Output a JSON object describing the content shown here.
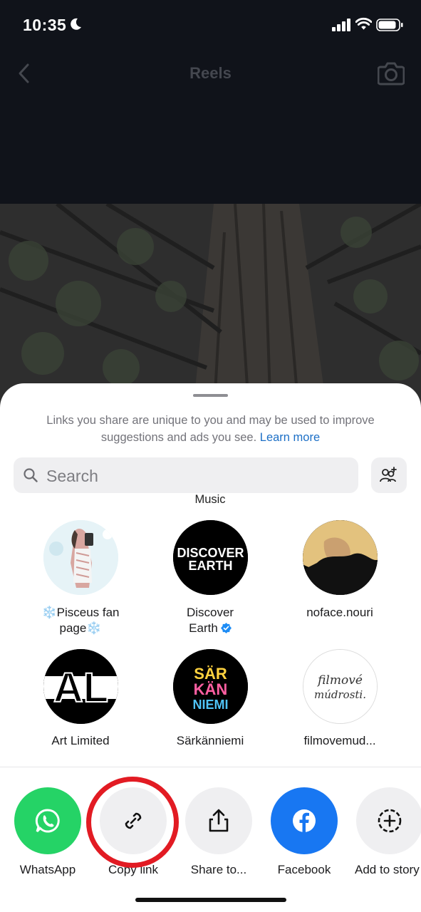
{
  "status_bar": {
    "time": "10:35"
  },
  "header": {
    "title": "Reels"
  },
  "sheet": {
    "notice": "Links you share are unique to you and may be used to improve suggestions and ads you see.",
    "learn_more": "Learn more",
    "search_placeholder": "Search",
    "partial_label": "Music"
  },
  "contacts": [
    {
      "line1": "❄️Pisceus fan",
      "line2": "page❄️",
      "verified": false
    },
    {
      "line1": "Discover",
      "line2": "Earth",
      "verified": true
    },
    {
      "line1": "noface.nouri",
      "line2": "",
      "verified": false
    },
    {
      "line1": "Art Limited",
      "line2": "",
      "verified": false
    },
    {
      "line1": "Särkänniemi",
      "line2": "",
      "verified": false
    },
    {
      "line1": "filmovemud...",
      "line2": "",
      "verified": false
    }
  ],
  "avatar_text": {
    "discover": [
      "DISCOVER",
      "EARTH"
    ],
    "art_limited": "AL",
    "sarkanniemi": [
      "SÄR",
      "KÄN",
      "NIEMI"
    ],
    "filmove": [
      "filmové",
      "múdrosti."
    ]
  },
  "actions": [
    {
      "label": "WhatsApp",
      "icon": "whatsapp-icon",
      "color": "#25d366"
    },
    {
      "label": "Copy link",
      "icon": "link-icon",
      "color": "#efeff1"
    },
    {
      "label": "Share to...",
      "icon": "share-icon",
      "color": "#efeff1"
    },
    {
      "label": "Facebook",
      "icon": "facebook-icon",
      "color": "#1877f2"
    },
    {
      "label": "Add to story",
      "icon": "add-story-icon",
      "color": "#efeff1"
    }
  ],
  "highlight_color": "#e21b23"
}
